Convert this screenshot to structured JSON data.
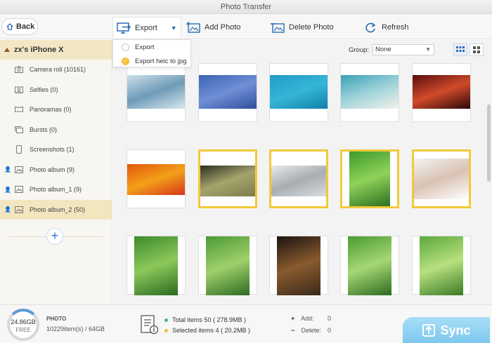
{
  "window": {
    "title": "Photo Transfer"
  },
  "toolbar": {
    "back_label": "Back",
    "export_label": "Export",
    "add_photo_label": "Add Photo",
    "delete_photo_label": "Delete Photo",
    "refresh_label": "Refresh"
  },
  "export_menu": {
    "items": [
      {
        "label": "Export",
        "selected": false
      },
      {
        "label": "Export heic to jpg",
        "selected": true
      }
    ]
  },
  "sidebar": {
    "device_name": "zx's iPhone X",
    "items": [
      {
        "label": "Camera roll (10161)",
        "icon": "camera-icon"
      },
      {
        "label": "Selfies (0)",
        "icon": "selfie-icon"
      },
      {
        "label": "Panoramas (0)",
        "icon": "panorama-icon"
      },
      {
        "label": "Bursts (0)",
        "icon": "burst-icon"
      },
      {
        "label": "Screenshots (1)",
        "icon": "phone-icon"
      },
      {
        "label": "Photo album (9)",
        "icon": "album-icon"
      },
      {
        "label": "Photo album_1 (9)",
        "icon": "album-icon"
      },
      {
        "label": "Photo album_2 (50)",
        "icon": "album-icon",
        "active": true
      }
    ]
  },
  "main": {
    "group_label": "Group:",
    "group_value": "None",
    "thumbnails": [
      {
        "name": "blue-forest-lake",
        "selected": false,
        "colors": [
          "#cfe0ea",
          "#6f9bb8",
          "#d9e6ee"
        ]
      },
      {
        "name": "blue-ice-pattern",
        "selected": false,
        "colors": [
          "#3c63b3",
          "#6f8fd6",
          "#2d4f9b"
        ]
      },
      {
        "name": "turquoise-water",
        "selected": false,
        "colors": [
          "#1f9cc4",
          "#35b6d8",
          "#137fa8"
        ]
      },
      {
        "name": "beach-shore",
        "selected": false,
        "colors": [
          "#3d9fb8",
          "#9ed3d9",
          "#f3f1ea"
        ]
      },
      {
        "name": "red-canyon",
        "selected": false,
        "colors": [
          "#5a0d0f",
          "#d14a2b",
          "#2b0808"
        ]
      },
      {
        "name": "autumn-leaves",
        "selected": false,
        "colors": [
          "#e0560c",
          "#f4a019",
          "#d4351a"
        ]
      },
      {
        "name": "grass-field",
        "selected": true,
        "colors": [
          "#2b2e22",
          "#a6a46d",
          "#7c7a4a"
        ]
      },
      {
        "name": "misty-lake",
        "selected": true,
        "colors": [
          "#e8eaec",
          "#a8adb1",
          "#d8dcdf"
        ]
      },
      {
        "name": "woman-in-forest",
        "selected": true,
        "colors": [
          "#3e9a2a",
          "#8fd25a",
          "#2c6e1e"
        ]
      },
      {
        "name": "woman-on-bed",
        "selected": true,
        "colors": [
          "#f2f2f2",
          "#d9c2b2",
          "#ffffff"
        ]
      },
      {
        "name": "woman-garden-1",
        "selected": false,
        "colors": [
          "#3d8b2c",
          "#8bc85a",
          "#2a6a1f"
        ]
      },
      {
        "name": "woman-garden-2",
        "selected": false,
        "colors": [
          "#4b9a34",
          "#9fd06a",
          "#2e6b22"
        ]
      },
      {
        "name": "woman-dark-room",
        "selected": false,
        "colors": [
          "#1a1410",
          "#8a5a2e",
          "#3a2a1a"
        ]
      },
      {
        "name": "woman-garden-3",
        "selected": false,
        "colors": [
          "#4a9a32",
          "#a6d874",
          "#2d6b21"
        ]
      },
      {
        "name": "woman-garden-4",
        "selected": false,
        "colors": [
          "#5aa83a",
          "#b7e07e",
          "#3a7a26"
        ]
      }
    ]
  },
  "footer": {
    "storage_gb": "24.86GB",
    "storage_free": "FREE",
    "category": "PHOTO",
    "item_count": "10229item(s) / 64GB",
    "total_items": "Total items 50 ( 278.9MB )",
    "selected_items": "Selected items 4 ( 20.2MB )",
    "add_label": "Add:",
    "add_value": "0",
    "delete_label": "Delete:",
    "delete_value": "0",
    "sync_label": "Sync",
    "colors": {
      "total_dot": "#3fbf7f",
      "selected_dot": "#f2c13b",
      "sync": "#8ccff2",
      "selection": "#f2c93a"
    }
  }
}
